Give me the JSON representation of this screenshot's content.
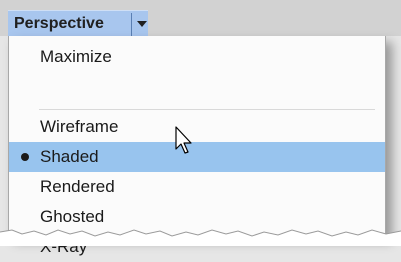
{
  "header": {
    "title": "Perspective",
    "dropdown_icon": "caret-down-icon"
  },
  "menu": {
    "items": [
      {
        "label": "Maximize",
        "selected": false
      },
      {
        "label": "Wireframe",
        "selected": false
      },
      {
        "label": "Shaded",
        "selected": true
      },
      {
        "label": "Rendered",
        "selected": false
      },
      {
        "label": "Ghosted",
        "selected": false
      },
      {
        "label": "X-Ray",
        "selected": false
      }
    ]
  },
  "colors": {
    "highlight": "#98c4ee",
    "title_button": "#a8c6ee"
  }
}
